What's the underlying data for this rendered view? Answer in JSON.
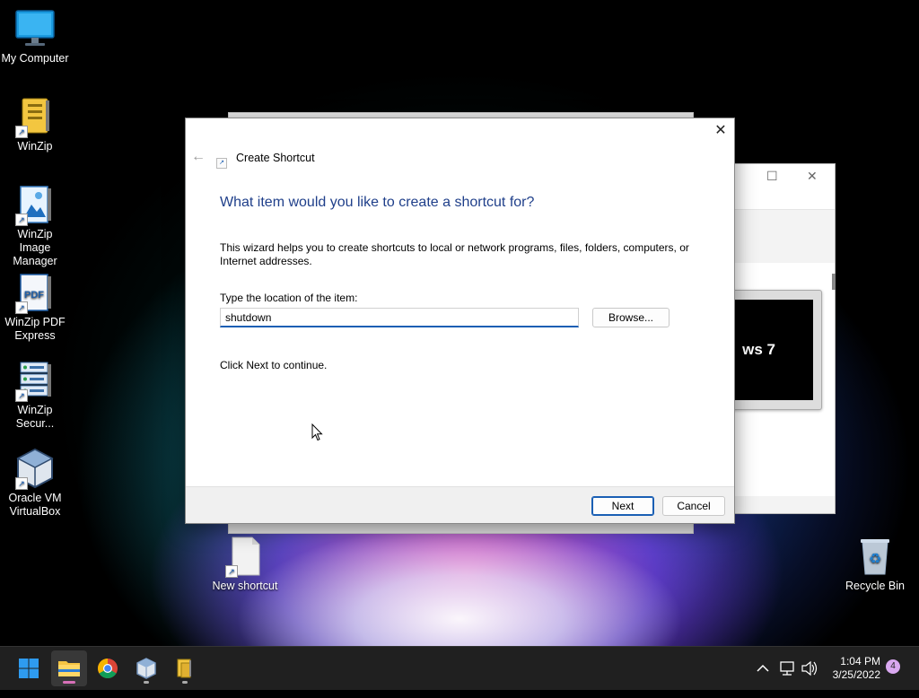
{
  "desktop": {
    "icons": [
      {
        "label": "My Computer"
      },
      {
        "label": "WinZip"
      },
      {
        "label": "WinZip Image Manager"
      },
      {
        "label": "WinZip PDF Express"
      },
      {
        "label": "WinZip Secur..."
      },
      {
        "label": "Oracle VM VirtualBox"
      },
      {
        "label": "New shortcut"
      },
      {
        "label": "Recycle Bin"
      }
    ],
    "pdf_icon_text": "PDF"
  },
  "background_window": {
    "screen_text": "ws 7"
  },
  "dialog": {
    "title": "Create Shortcut",
    "heading": "What item would you like to create a shortcut for?",
    "intro": "This wizard helps you to create shortcuts to local or network programs, files, folders, computers, or Internet addresses.",
    "location_label": "Type the location of the item:",
    "location_value": "shutdown",
    "browse_label": "Browse...",
    "continue_text": "Click Next to continue.",
    "next_label": "Next",
    "cancel_label": "Cancel"
  },
  "taskbar": {
    "time": "1:04 PM",
    "date": "3/25/2022",
    "notification_count": "4"
  },
  "colors": {
    "accent": "#1a5fb4",
    "heading": "#1f3f8a",
    "taskbar": "#202020"
  }
}
